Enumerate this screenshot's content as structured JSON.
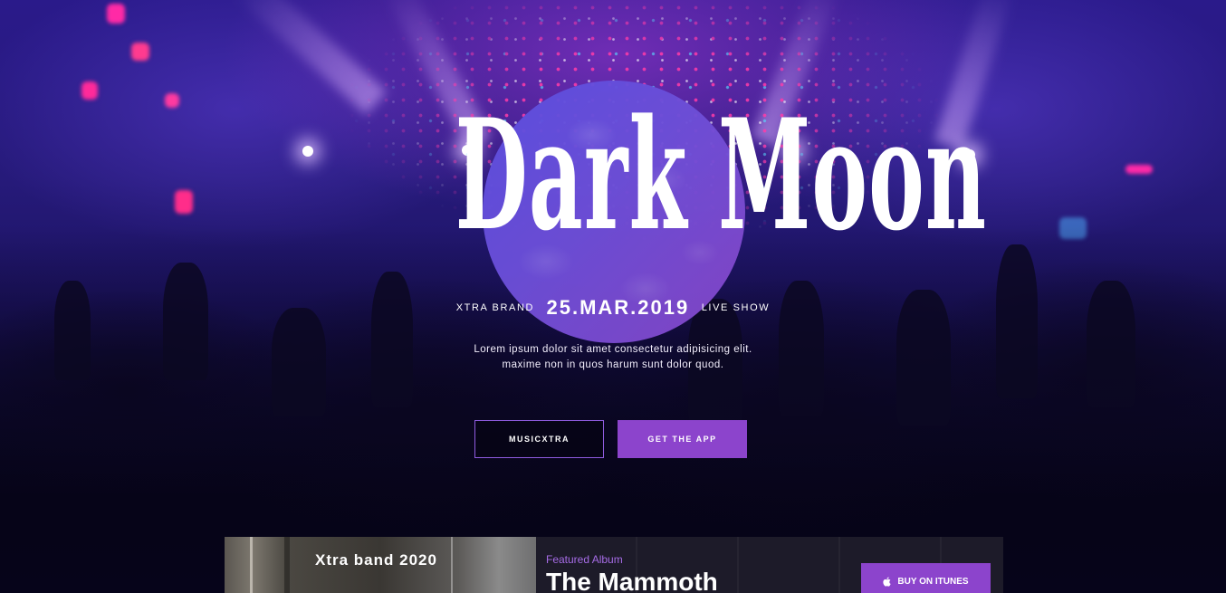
{
  "hero": {
    "title": "Dark Moon",
    "brand": "XTRA BRAND",
    "date": "25.MAR.2019",
    "event_type": "LIVE SHOW",
    "description_line1": "Lorem ipsum dolor sit amet consectetur adipisicing elit.",
    "description_line2": "maxime non in quos harum sunt dolor quod."
  },
  "buttons": {
    "primary_outline": "MUSICXTRA",
    "primary_fill": "GET THE APP"
  },
  "album": {
    "cover_title": "Xtra band 2020",
    "kicker": "Featured Album",
    "name": "The Mammoth",
    "buy_label": "BUY ON ITUNES",
    "buy_icon": "apple-icon"
  },
  "colors": {
    "accent": "#8c44cc",
    "moon": "#6a50dc",
    "kicker": "#a66ce6"
  }
}
